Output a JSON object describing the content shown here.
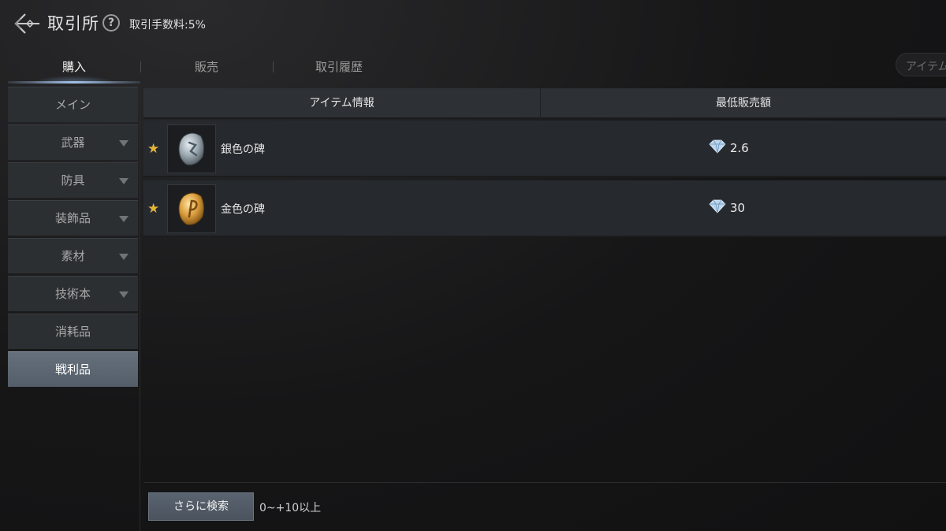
{
  "header": {
    "title": "取引所",
    "help_symbol": "?",
    "fee_text": "取引手数料:5%"
  },
  "tabs": [
    {
      "label": "購入",
      "active": true
    },
    {
      "label": "販売",
      "active": false
    },
    {
      "label": "取引履歴",
      "active": false
    }
  ],
  "search": {
    "placeholder": "アイテム"
  },
  "sidebar": {
    "items": [
      {
        "label": "メイン",
        "has_arrow": false,
        "active": false
      },
      {
        "label": "武器",
        "has_arrow": true,
        "active": false
      },
      {
        "label": "防具",
        "has_arrow": true,
        "active": false
      },
      {
        "label": "装飾品",
        "has_arrow": true,
        "active": false
      },
      {
        "label": "素材",
        "has_arrow": true,
        "active": false
      },
      {
        "label": "技術本",
        "has_arrow": true,
        "active": false
      },
      {
        "label": "消耗品",
        "has_arrow": false,
        "active": false
      },
      {
        "label": "戦利品",
        "has_arrow": false,
        "active": true
      }
    ]
  },
  "table": {
    "columns": [
      "アイテム情報",
      "最低販売額"
    ],
    "rows": [
      {
        "name": "銀色の碑",
        "price": "2.6",
        "favorite": true,
        "icon": "silver-rune-icon"
      },
      {
        "name": "金色の碑",
        "price": "30",
        "favorite": true,
        "icon": "gold-rune-icon"
      }
    ]
  },
  "footer": {
    "more_search_label": "さらに検索",
    "filter_text": "0~+10以上"
  },
  "colors": {
    "accent": "#e2b43a",
    "active_tab_bg": "#5a6470",
    "row_bg": "#262a2e"
  }
}
